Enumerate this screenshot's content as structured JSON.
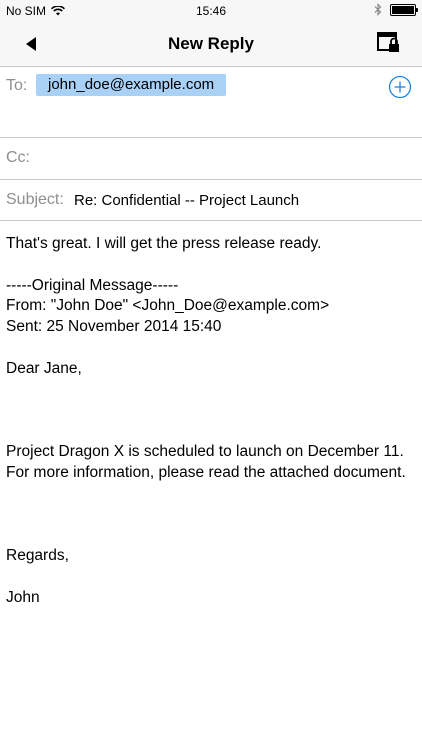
{
  "status_bar": {
    "carrier": "No SIM",
    "time": "15:46"
  },
  "navbar": {
    "title": "New Reply",
    "back_icon": "back-arrow-icon",
    "secure_icon": "lock-window-icon"
  },
  "compose": {
    "to_label": "To:",
    "to_recipient": "john_doe@example.com",
    "cc_label": "Cc:",
    "subject_label": "Subject:",
    "subject_value": "Re: Confidential -- Project Launch"
  },
  "body": {
    "reply_line": "That's great. I will get the press release ready.",
    "original_header": "-----Original Message-----",
    "from_line": "From: \"John Doe\" <John_Doe@example.com>",
    "sent_line": "Sent: 25 November 2014 15:40",
    "greeting": "Dear Jane,",
    "paragraph": "Project Dragon X is scheduled to launch on December 11. For more information, please read the attached document.",
    "closing": "Regards,",
    "signature": "John"
  },
  "colors": {
    "accent": "#1a82e2",
    "chip": "#a8d1f5",
    "label_gray": "#8e8e93",
    "separator": "#c8c7cc"
  }
}
